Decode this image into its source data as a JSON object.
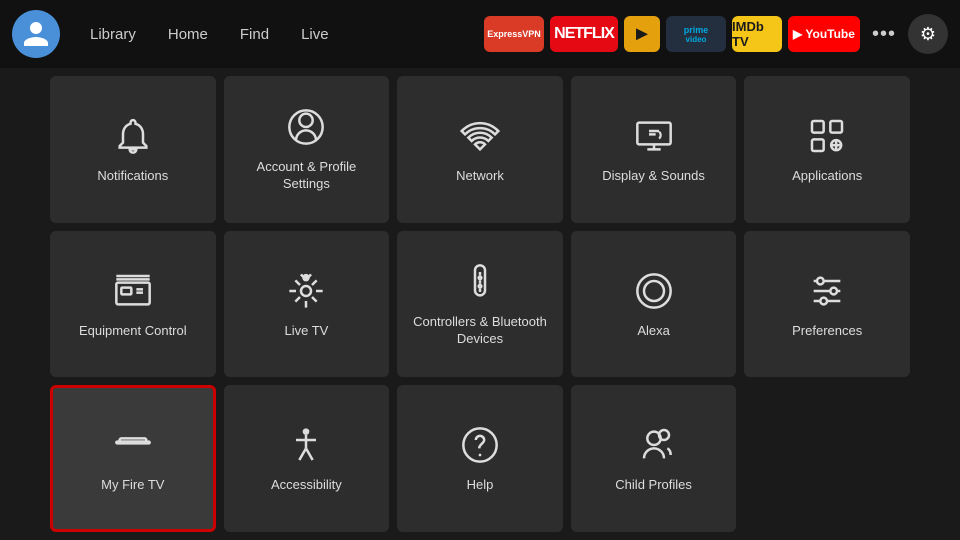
{
  "nav": {
    "links": [
      {
        "label": "Library"
      },
      {
        "label": "Home"
      },
      {
        "label": "Find"
      },
      {
        "label": "Live"
      }
    ],
    "apps": [
      {
        "id": "expressvpn",
        "label": "ExpressVPN",
        "class": "expressvpn"
      },
      {
        "id": "netflix",
        "label": "NETFLIX",
        "class": "netflix"
      },
      {
        "id": "plex",
        "label": "►",
        "class": "plex"
      },
      {
        "id": "prime",
        "label": "prime video",
        "class": "prime"
      },
      {
        "id": "imdb",
        "label": "IMDb TV",
        "class": "imdb"
      },
      {
        "id": "youtube",
        "label": "▶ YouTube",
        "class": "youtube"
      }
    ],
    "more_label": "•••",
    "settings_icon": "⚙"
  },
  "grid": {
    "items": [
      {
        "id": "notifications",
        "label": "Notifications",
        "icon": "bell"
      },
      {
        "id": "account-profile",
        "label": "Account & Profile Settings",
        "icon": "person-circle"
      },
      {
        "id": "network",
        "label": "Network",
        "icon": "wifi"
      },
      {
        "id": "display-sounds",
        "label": "Display & Sounds",
        "icon": "display"
      },
      {
        "id": "applications",
        "label": "Applications",
        "icon": "grid-plus"
      },
      {
        "id": "equipment-control",
        "label": "Equipment Control",
        "icon": "tv"
      },
      {
        "id": "live-tv",
        "label": "Live TV",
        "icon": "antenna"
      },
      {
        "id": "controllers-bluetooth",
        "label": "Controllers & Bluetooth Devices",
        "icon": "remote"
      },
      {
        "id": "alexa",
        "label": "Alexa",
        "icon": "alexa"
      },
      {
        "id": "preferences",
        "label": "Preferences",
        "icon": "sliders"
      },
      {
        "id": "my-fire-tv",
        "label": "My Fire TV",
        "icon": "firetv",
        "selected": true
      },
      {
        "id": "accessibility",
        "label": "Accessibility",
        "icon": "accessibility"
      },
      {
        "id": "help",
        "label": "Help",
        "icon": "help"
      },
      {
        "id": "child-profiles",
        "label": "Child Profiles",
        "icon": "child-profile"
      }
    ]
  }
}
